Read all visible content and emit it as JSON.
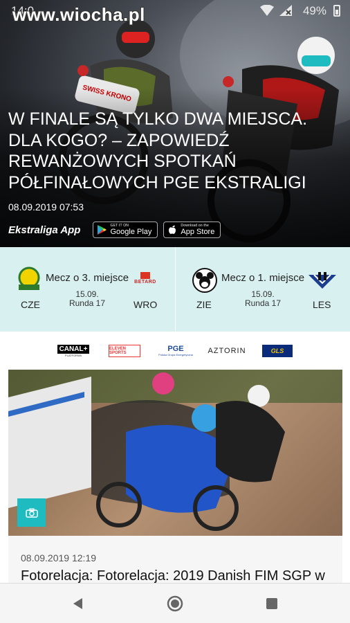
{
  "status_bar": {
    "time": "14:0",
    "watermark": "www.wiocha.pl",
    "battery_text": "49%",
    "battery_level": 0.49
  },
  "hero": {
    "title": "W FINALE SĄ TYLKO DWA MIEJSCA. DLA KOGO? – ZAPOWIEDŹ REWANŻOWYCH SPOTKAŃ PÓŁFINAŁOWYCH PGE EKSTRALIGI",
    "date": "08.09.2019 07:53",
    "app_label": "Ekstraliga App",
    "google_play": {
      "small": "GET IT ON",
      "big": "Google Play"
    },
    "app_store": {
      "small": "Download on the",
      "big": "App Store"
    }
  },
  "matches": [
    {
      "title": "Mecz o 3. miejsce",
      "date": "15.09.",
      "round": "Runda 17",
      "home": "CZE",
      "away": "WRO",
      "home_logo": "grudziadz-logo",
      "away_logo": "betard-logo",
      "away_logo_text": "BETARD"
    },
    {
      "title": "Mecz o 1. miejsce",
      "date": "15.09.",
      "round": "Runda 17",
      "home": "ZIE",
      "away": "LES",
      "home_logo": "mouse-logo",
      "away_logo": "unia-logo"
    }
  ],
  "sponsors": [
    {
      "name": "canal-plus-logo",
      "text": "CANAL+",
      "sub": "PLATFORMA"
    },
    {
      "name": "eleven-sports-logo",
      "text": "ELEVEN SPORTS"
    },
    {
      "name": "pge-logo",
      "text": "PGE",
      "sub": "Polska Grupa Energetyczna"
    },
    {
      "name": "aztorin-logo",
      "text": "AZTORIN"
    },
    {
      "name": "gls-logo",
      "text": "GLS"
    }
  ],
  "article": {
    "date": "08.09.2019 12:19",
    "title": "Fotorelacja: Fotorelacja: 2019 Danish FIM SGP w"
  },
  "colors": {
    "accent": "#1ebbc0",
    "band": "#d8f1f0"
  }
}
